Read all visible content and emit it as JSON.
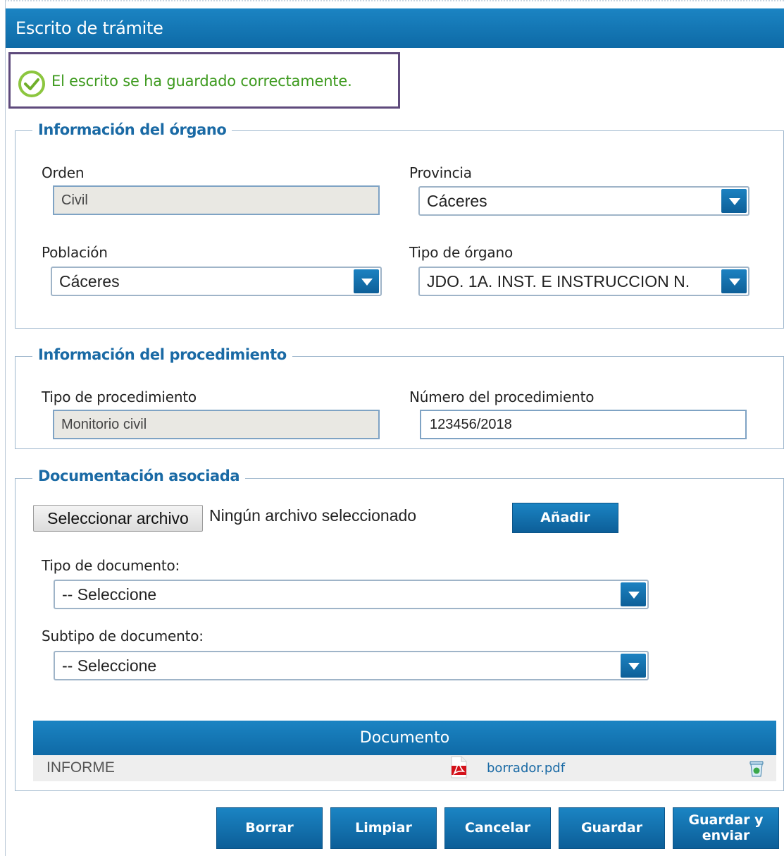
{
  "window": {
    "title": "Escrito de trámite"
  },
  "notice": {
    "message": "El escrito se ha guardado correctamente."
  },
  "organo": {
    "legend": "Información del órgano",
    "orden_label": "Orden",
    "orden_value": "Civil",
    "provincia_label": "Provincia",
    "provincia_value": "Cáceres",
    "poblacion_label": "Población",
    "poblacion_value": "Cáceres",
    "tipo_organo_label": "Tipo de órgano",
    "tipo_organo_value": "JDO. 1A. INST. E INSTRUCCION N."
  },
  "procedimiento": {
    "legend": "Información del procedimiento",
    "tipo_label": "Tipo de procedimiento",
    "tipo_value": "Monitorio civil",
    "numero_label": "Número del procedimiento",
    "numero_value": "123456/2018"
  },
  "documentacion": {
    "legend": "Documentación asociada",
    "file_button": "Seleccionar archivo",
    "file_status": "Ningún archivo seleccionado",
    "add_button": "Añadir",
    "tipo_doc_label": "Tipo de documento:",
    "tipo_doc_value": "-- Seleccione",
    "subtipo_doc_label": "Subtipo de documento:",
    "subtipo_doc_value": "-- Seleccione",
    "table": {
      "header": "Documento",
      "rows": [
        {
          "type": "INFORME",
          "file": "borrador.pdf",
          "file_icon": "pdf-icon",
          "action_icon": "delete-icon"
        }
      ]
    }
  },
  "actions": {
    "borrar": "Borrar",
    "limpiar": "Limpiar",
    "cancelar": "Cancelar",
    "guardar": "Guardar",
    "guardar_enviar_line1": "Guardar y",
    "guardar_enviar_line2": "enviar"
  },
  "colors": {
    "primary": "#1578b8",
    "success": "#3d9a1e",
    "notice_border": "#5e4a7c"
  }
}
